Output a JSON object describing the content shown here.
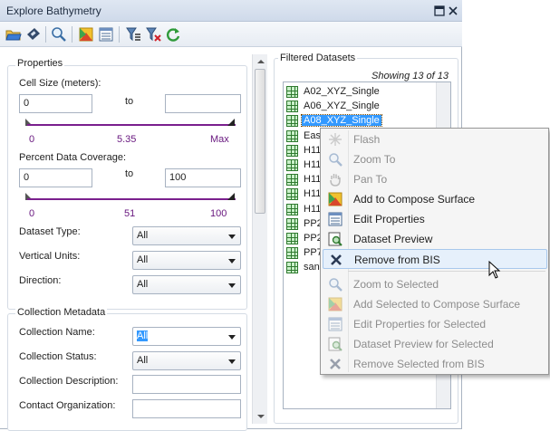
{
  "window": {
    "title": "Explore Bathymetry"
  },
  "toolbar": {
    "icons": [
      "open-folder-icon",
      "save-icon",
      "search-icon",
      "compose-surface-icon",
      "properties-icon",
      "filter-icon",
      "clear-filter-icon",
      "refresh-icon"
    ]
  },
  "properties": {
    "title": "Properties",
    "cell_size": {
      "label": "Cell Size (meters):",
      "min_value": "0",
      "to_label": "to",
      "max_value": "",
      "slider_min": "0",
      "slider_mid": "5.35",
      "slider_max": "Max"
    },
    "coverage": {
      "label": "Percent Data Coverage:",
      "min_value": "0",
      "to_label": "to",
      "max_value": "100",
      "slider_min": "0",
      "slider_mid": "51",
      "slider_max": "100"
    },
    "dataset_type": {
      "label": "Dataset Type:",
      "value": "All"
    },
    "vertical_units": {
      "label": "Vertical Units:",
      "value": "All"
    },
    "direction": {
      "label": "Direction:",
      "value": "All"
    }
  },
  "metadata": {
    "title": "Collection Metadata",
    "collection_name": {
      "label": "Collection Name:",
      "value": "All"
    },
    "collection_status": {
      "label": "Collection Status:",
      "value": "All"
    },
    "collection_description": {
      "label": "Collection Description:",
      "value": ""
    },
    "contact_organization": {
      "label": "Contact Organization:",
      "value": ""
    }
  },
  "filtered": {
    "title": "Filtered Datasets",
    "showing": "Showing 13 of 13",
    "items": [
      {
        "label": "A02_XYZ_Single",
        "selected": false
      },
      {
        "label": "A06_XYZ_Single",
        "selected": false
      },
      {
        "label": "A08_XYZ_Single",
        "selected": true
      },
      {
        "label": "Eas",
        "selected": false
      },
      {
        "label": "H11",
        "selected": false
      },
      {
        "label": "H11",
        "selected": false
      },
      {
        "label": "H11",
        "selected": false
      },
      {
        "label": "H11",
        "selected": false
      },
      {
        "label": "H11",
        "selected": false
      },
      {
        "label": "PP2",
        "selected": false
      },
      {
        "label": "PP2",
        "selected": false
      },
      {
        "label": "PP7",
        "selected": false
      },
      {
        "label": "san",
        "selected": false
      }
    ]
  },
  "context_menu": {
    "items": [
      {
        "label": "Flash",
        "icon": "flash-icon",
        "enabled": false
      },
      {
        "label": "Zoom To",
        "icon": "zoom-icon",
        "enabled": false
      },
      {
        "label": "Pan To",
        "icon": "pan-hand-icon",
        "enabled": false
      },
      {
        "label": "Add to Compose Surface",
        "icon": "compose-surface-icon",
        "enabled": true
      },
      {
        "label": "Edit Properties",
        "icon": "properties-icon",
        "enabled": true
      },
      {
        "label": "Dataset Preview",
        "icon": "preview-icon",
        "enabled": true
      },
      {
        "label": "Remove from BIS",
        "icon": "remove-x-icon",
        "enabled": true,
        "hover": true
      },
      {
        "label": "Zoom to Selected",
        "icon": "zoom-icon",
        "enabled": false
      },
      {
        "label": "Add Selected to Compose Surface",
        "icon": "compose-surface-icon",
        "enabled": false
      },
      {
        "label": "Edit Properties for Selected",
        "icon": "properties-icon",
        "enabled": false
      },
      {
        "label": "Dataset Preview for Selected",
        "icon": "preview-icon",
        "enabled": false
      },
      {
        "label": "Remove Selected from BIS",
        "icon": "remove-x-icon",
        "enabled": false
      }
    ]
  }
}
